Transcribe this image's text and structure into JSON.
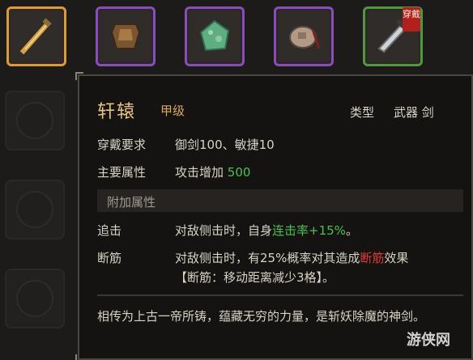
{
  "slots": [
    {
      "name": "sword-icon",
      "rarity": "orange"
    },
    {
      "name": "armor-icon",
      "rarity": "purple"
    },
    {
      "name": "jade-stone-icon",
      "rarity": "purple"
    },
    {
      "name": "pouch-icon",
      "rarity": "purple"
    },
    {
      "name": "blade-icon",
      "rarity": "green",
      "badge": "穿戴"
    }
  ],
  "tooltip": {
    "name": "轩辕",
    "grade": "甲级",
    "type_label": "类型",
    "type_value": "武器 剑",
    "requirements": {
      "label": "穿戴要求",
      "value": "御剑100、敏捷10"
    },
    "main_attr": {
      "label": "主要属性",
      "value_text": "攻击增加 ",
      "value_num": "500"
    },
    "extra_section": "附加属性",
    "effects": [
      {
        "label": "追击",
        "pre": "对敌侧击时，自身",
        "highlight": "连击率+15%",
        "post": "。"
      },
      {
        "label": "断筋",
        "pre": "对敌侧击时，有25%概率对其造成",
        "highlight": "断筋",
        "post": "效果",
        "line2": "【断筋：移动距离减少3格】。"
      }
    ],
    "description": "相传为上古一帝所铸，蕴藏无穷的力量，是斩妖除魔的神剑。"
  },
  "watermark": "游侠网",
  "colors": {
    "orange": "#e39a2b",
    "purple": "#8a4bbd",
    "green": "#4d9a3c",
    "highlight_green": "#47c24a",
    "highlight_red": "#e03a34",
    "title_gold": "#e8c27a"
  }
}
